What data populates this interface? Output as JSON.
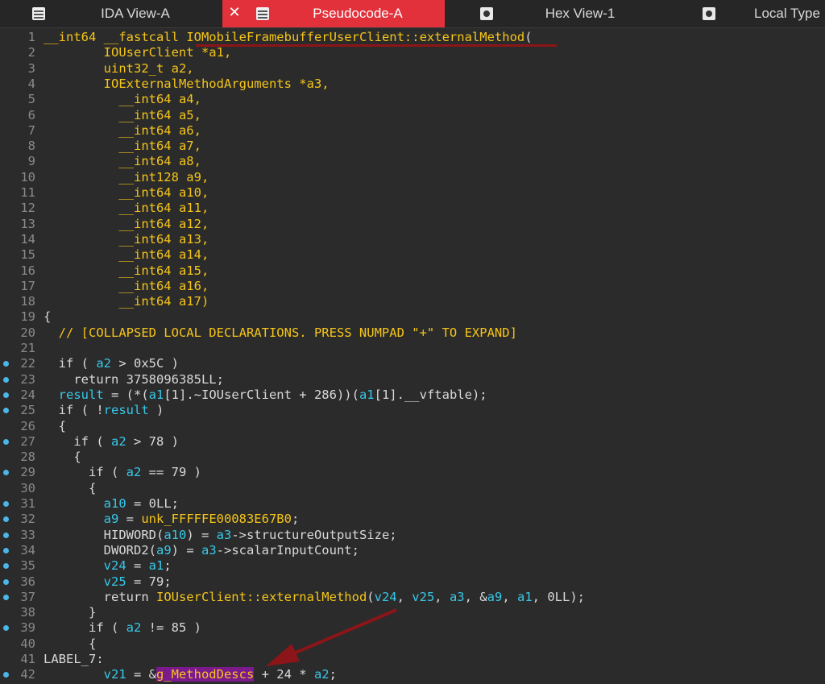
{
  "tabs": [
    {
      "label": "IDA View-A",
      "icon": "grid-icon",
      "active": false
    },
    {
      "label": "Pseudocode-A",
      "icon": "grid-icon",
      "active": true
    },
    {
      "label": "Hex View-1",
      "icon": "hex-icon",
      "active": false
    },
    {
      "label": "Local Type",
      "icon": "local-types-icon",
      "active": false
    }
  ],
  "close_glyph": "✕",
  "colors": {
    "accent": "#e2313b",
    "keyword_yellow": "#f5c518",
    "variable_cyan": "#37c8e8",
    "breakpoint_dot": "#4ab7e8",
    "highlight_purple": "#7a1a8c",
    "arrow_red": "#8b1518"
  },
  "lines": [
    {
      "n": "1",
      "dot": false,
      "segs": [
        [
          "ty",
          "__int64 __fastcall "
        ],
        [
          "fn",
          "IOMobileFramebufferUserClient::externalMethod"
        ],
        [
          "pl",
          "("
        ]
      ]
    },
    {
      "n": "2",
      "dot": false,
      "segs": [
        [
          "ty",
          "        IOUserClient *a1,"
        ]
      ]
    },
    {
      "n": "3",
      "dot": false,
      "segs": [
        [
          "ty",
          "        uint32_t a2,"
        ]
      ]
    },
    {
      "n": "4",
      "dot": false,
      "segs": [
        [
          "ty",
          "        IOExternalMethodArguments *a3,"
        ]
      ]
    },
    {
      "n": "5",
      "dot": false,
      "segs": [
        [
          "ty",
          "          __int64 a4,"
        ]
      ]
    },
    {
      "n": "6",
      "dot": false,
      "segs": [
        [
          "ty",
          "          __int64 a5,"
        ]
      ]
    },
    {
      "n": "7",
      "dot": false,
      "segs": [
        [
          "ty",
          "          __int64 a6,"
        ]
      ]
    },
    {
      "n": "8",
      "dot": false,
      "segs": [
        [
          "ty",
          "          __int64 a7,"
        ]
      ]
    },
    {
      "n": "9",
      "dot": false,
      "segs": [
        [
          "ty",
          "          __int64 a8,"
        ]
      ]
    },
    {
      "n": "10",
      "dot": false,
      "segs": [
        [
          "ty",
          "          __int128 a9,"
        ]
      ]
    },
    {
      "n": "11",
      "dot": false,
      "segs": [
        [
          "ty",
          "          __int64 a10,"
        ]
      ]
    },
    {
      "n": "12",
      "dot": false,
      "segs": [
        [
          "ty",
          "          __int64 a11,"
        ]
      ]
    },
    {
      "n": "13",
      "dot": false,
      "segs": [
        [
          "ty",
          "          __int64 a12,"
        ]
      ]
    },
    {
      "n": "14",
      "dot": false,
      "segs": [
        [
          "ty",
          "          __int64 a13,"
        ]
      ]
    },
    {
      "n": "15",
      "dot": false,
      "segs": [
        [
          "ty",
          "          __int64 a14,"
        ]
      ]
    },
    {
      "n": "16",
      "dot": false,
      "segs": [
        [
          "ty",
          "          __int64 a15,"
        ]
      ]
    },
    {
      "n": "17",
      "dot": false,
      "segs": [
        [
          "ty",
          "          __int64 a16,"
        ]
      ]
    },
    {
      "n": "18",
      "dot": false,
      "segs": [
        [
          "ty",
          "          __int64 a17)"
        ]
      ]
    },
    {
      "n": "19",
      "dot": false,
      "segs": [
        [
          "pl",
          "{"
        ]
      ]
    },
    {
      "n": "20",
      "dot": false,
      "segs": [
        [
          "cm",
          "  // [COLLAPSED LOCAL DECLARATIONS. PRESS NUMPAD \"+\" TO EXPAND]"
        ]
      ]
    },
    {
      "n": "21",
      "dot": false,
      "segs": []
    },
    {
      "n": "22",
      "dot": true,
      "segs": [
        [
          "kw",
          "  if ( "
        ],
        [
          "va",
          "a2"
        ],
        [
          "pl",
          " > 0x5C )"
        ]
      ]
    },
    {
      "n": "23",
      "dot": true,
      "segs": [
        [
          "kw",
          "    return "
        ],
        [
          "pl",
          "3758096385LL;"
        ]
      ]
    },
    {
      "n": "24",
      "dot": true,
      "segs": [
        [
          "va",
          "  result"
        ],
        [
          "pl",
          " = (*("
        ],
        [
          "va",
          "a1"
        ],
        [
          "pl",
          "[1].~IOUserClient + 286))("
        ],
        [
          "va",
          "a1"
        ],
        [
          "pl",
          "[1].__vftable);"
        ]
      ]
    },
    {
      "n": "25",
      "dot": true,
      "segs": [
        [
          "kw",
          "  if ( !"
        ],
        [
          "va",
          "result"
        ],
        [
          "pl",
          " )"
        ]
      ]
    },
    {
      "n": "26",
      "dot": false,
      "segs": [
        [
          "pl",
          "  {"
        ]
      ]
    },
    {
      "n": "27",
      "dot": true,
      "segs": [
        [
          "kw",
          "    if ( "
        ],
        [
          "va",
          "a2"
        ],
        [
          "pl",
          " > 78 )"
        ]
      ]
    },
    {
      "n": "28",
      "dot": false,
      "segs": [
        [
          "pl",
          "    {"
        ]
      ]
    },
    {
      "n": "29",
      "dot": true,
      "segs": [
        [
          "kw",
          "      if ( "
        ],
        [
          "va",
          "a2"
        ],
        [
          "pl",
          " == 79 )"
        ]
      ]
    },
    {
      "n": "30",
      "dot": false,
      "segs": [
        [
          "pl",
          "      {"
        ]
      ]
    },
    {
      "n": "31",
      "dot": true,
      "segs": [
        [
          "va",
          "        a10"
        ],
        [
          "pl",
          " = 0LL;"
        ]
      ]
    },
    {
      "n": "32",
      "dot": true,
      "segs": [
        [
          "va",
          "        a9"
        ],
        [
          "pl",
          " = "
        ],
        [
          "ty",
          "unk_FFFFFE00083E67B0"
        ],
        [
          "pl",
          ";"
        ]
      ]
    },
    {
      "n": "33",
      "dot": true,
      "segs": [
        [
          "pl",
          "        HIDWORD("
        ],
        [
          "va",
          "a10"
        ],
        [
          "pl",
          ") = "
        ],
        [
          "va",
          "a3"
        ],
        [
          "pl",
          "->structureOutputSize;"
        ]
      ]
    },
    {
      "n": "34",
      "dot": true,
      "segs": [
        [
          "pl",
          "        DWORD2("
        ],
        [
          "va",
          "a9"
        ],
        [
          "pl",
          ") = "
        ],
        [
          "va",
          "a3"
        ],
        [
          "pl",
          "->scalarInputCount;"
        ]
      ]
    },
    {
      "n": "35",
      "dot": true,
      "segs": [
        [
          "va",
          "        v24"
        ],
        [
          "pl",
          " = "
        ],
        [
          "va",
          "a1"
        ],
        [
          "pl",
          ";"
        ]
      ]
    },
    {
      "n": "36",
      "dot": true,
      "segs": [
        [
          "va",
          "        v25"
        ],
        [
          "pl",
          " = 79;"
        ]
      ]
    },
    {
      "n": "37",
      "dot": true,
      "segs": [
        [
          "kw",
          "        return "
        ],
        [
          "fn",
          "IOUserClient::externalMethod"
        ],
        [
          "pl",
          "("
        ],
        [
          "va",
          "v24"
        ],
        [
          "pl",
          ", "
        ],
        [
          "va",
          "v25"
        ],
        [
          "pl",
          ", "
        ],
        [
          "va",
          "a3"
        ],
        [
          "pl",
          ", &"
        ],
        [
          "va",
          "a9"
        ],
        [
          "pl",
          ", "
        ],
        [
          "va",
          "a1"
        ],
        [
          "pl",
          ", 0LL);"
        ]
      ]
    },
    {
      "n": "38",
      "dot": false,
      "segs": [
        [
          "pl",
          "      }"
        ]
      ]
    },
    {
      "n": "39",
      "dot": true,
      "segs": [
        [
          "kw",
          "      if ( "
        ],
        [
          "va",
          "a2"
        ],
        [
          "pl",
          " != 85 )"
        ]
      ]
    },
    {
      "n": "40",
      "dot": false,
      "segs": [
        [
          "pl",
          "      {"
        ]
      ]
    },
    {
      "n": "41",
      "dot": false,
      "segs": [
        [
          "pl",
          "LABEL_7:"
        ]
      ]
    },
    {
      "n": "42",
      "dot": true,
      "segs": [
        [
          "va",
          "        v21"
        ],
        [
          "pl",
          " = &"
        ],
        [
          "hl",
          "g_MethodDescs"
        ],
        [
          "pl",
          " + 24 * "
        ],
        [
          "va",
          "a2"
        ],
        [
          "pl",
          ";"
        ]
      ]
    }
  ]
}
